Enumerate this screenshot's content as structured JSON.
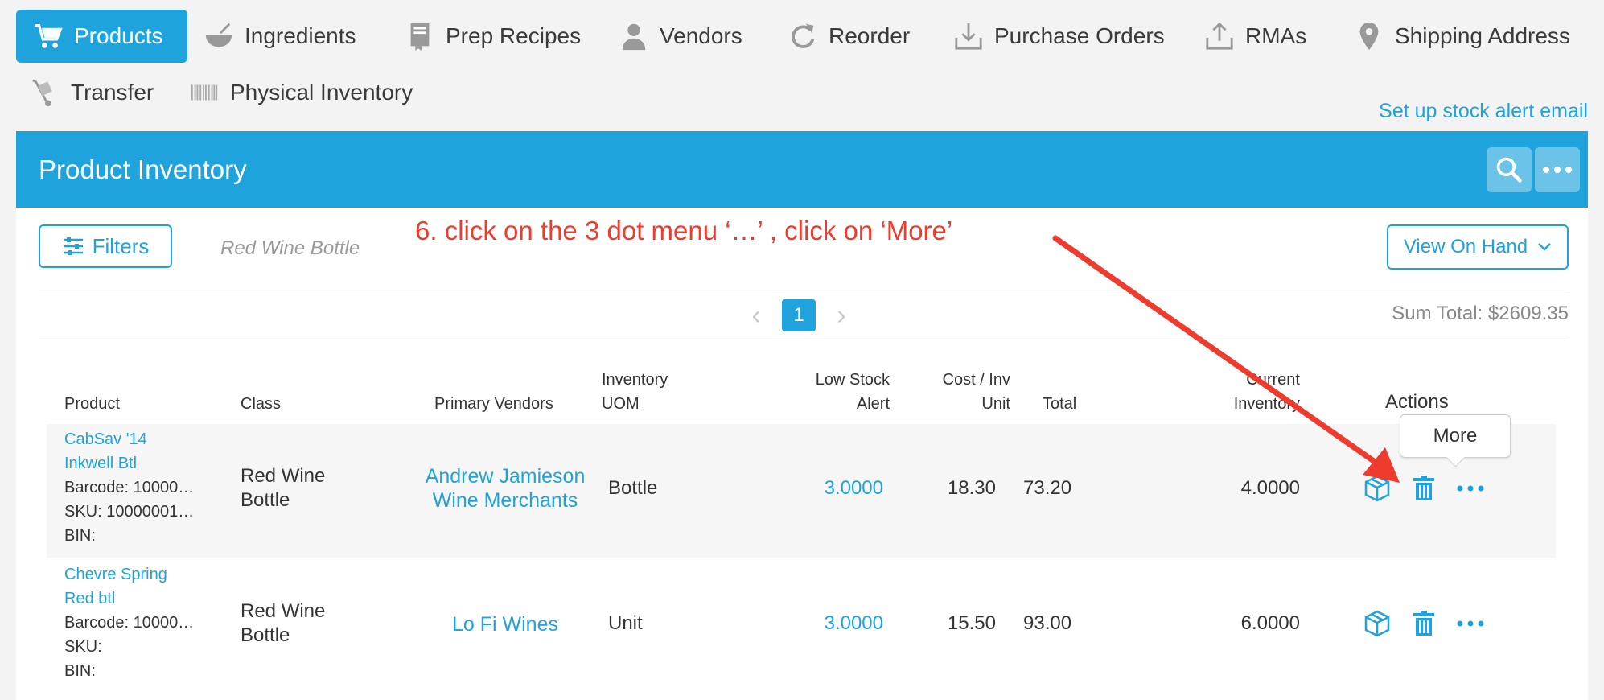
{
  "nav": {
    "items": [
      {
        "label": "Products",
        "icon": "cart-icon",
        "active": true
      },
      {
        "label": "Ingredients",
        "icon": "bowl-icon"
      },
      {
        "label": "Prep Recipes",
        "icon": "book-icon"
      },
      {
        "label": "Vendors",
        "icon": "person-icon"
      },
      {
        "label": "Reorder",
        "icon": "refresh-icon"
      },
      {
        "label": "Purchase Orders",
        "icon": "download-tray-icon"
      },
      {
        "label": "RMAs",
        "icon": "upload-tray-icon"
      },
      {
        "label": "Shipping Address",
        "icon": "map-pin-icon"
      },
      {
        "label": "Transfer",
        "icon": "hand-truck-icon"
      },
      {
        "label": "Physical Inventory",
        "icon": "barcode-icon"
      }
    ],
    "stock_alert_link": "Set up stock alert email"
  },
  "panel": {
    "title": "Product Inventory",
    "filters_label": "Filters",
    "filter_tag": "Red Wine Bottle",
    "view_label": "View On Hand",
    "pager": {
      "prev": "‹",
      "current": "1",
      "next": "›"
    },
    "sum_total": "Sum Total: $2609.35"
  },
  "table": {
    "headers": {
      "product": "Product",
      "class": "Class",
      "vendors": "Primary Vendors",
      "uom_1": "Inventory",
      "uom_2": "UOM",
      "low_1": "Low Stock",
      "low_2": "Alert",
      "cost_1": "Cost / Inv",
      "cost_2": "Unit",
      "total": "Total",
      "cur_1": "Current",
      "cur_2": "Inventory",
      "actions": "Actions"
    },
    "rows": [
      {
        "name_1": "CabSav '14",
        "name_2": "Inkwell Btl",
        "barcode": "Barcode: 10000…",
        "sku": "SKU: 10000001…",
        "bin": "BIN:",
        "class_1": "Red Wine",
        "class_2": "Bottle",
        "vendor_1": "Andrew Jamieson",
        "vendor_2": "Wine Merchants",
        "uom": "Bottle",
        "low": "3.0000",
        "cost": "18.30",
        "total": "73.20",
        "current": "4.0000"
      },
      {
        "name_1": "Chevre Spring",
        "name_2": "Red btl",
        "barcode": "Barcode: 10000…",
        "sku": "SKU:",
        "bin": "BIN:",
        "class_1": "Red Wine",
        "class_2": "Bottle",
        "vendor_1": "Lo Fi Wines",
        "vendor_2": "",
        "uom": "Unit",
        "low": "3.0000",
        "cost": "15.50",
        "total": "93.00",
        "current": "6.0000"
      }
    ],
    "tooltip": "More"
  },
  "annotation": "6. click on the 3 dot menu ‘…’ , click on ‘More’",
  "colors": {
    "accent": "#1ea3dc",
    "annotation": "#ee3b2e"
  }
}
